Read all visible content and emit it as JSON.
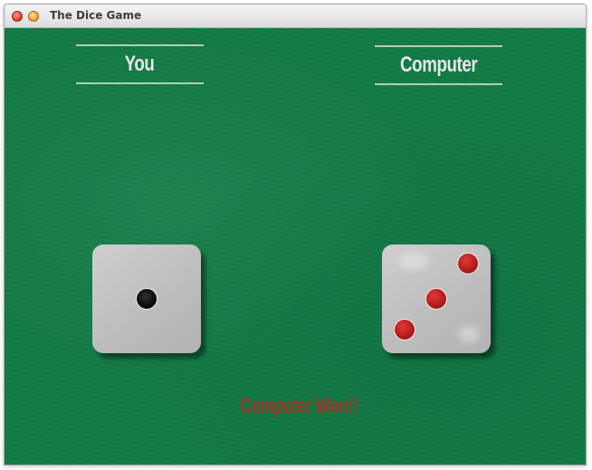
{
  "window": {
    "title": "The Dice Game"
  },
  "players": {
    "you": {
      "label": "You",
      "die_value": 1,
      "pip_color": "#000000"
    },
    "computer": {
      "label": "Computer",
      "die_value": 3,
      "pip_color": "#b41d1a"
    }
  },
  "result": {
    "text": "Computer Won!!",
    "color": "#a4342a"
  },
  "colors": {
    "felt": "#127a45",
    "die": "#bdbdbd"
  }
}
